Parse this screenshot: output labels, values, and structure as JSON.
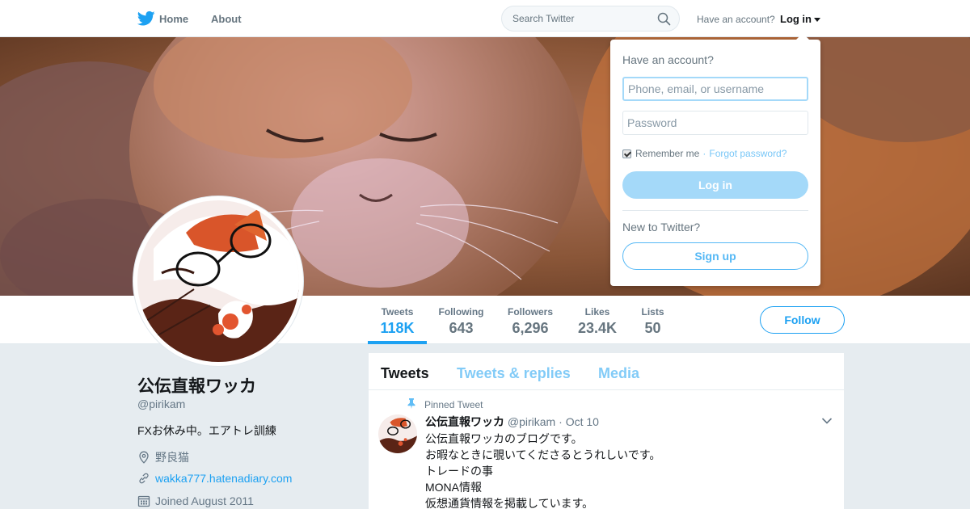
{
  "nav": {
    "home_label": "Home",
    "about_label": "About",
    "search_placeholder": "Search Twitter",
    "have_account": "Have an account?",
    "login_label": "Log in"
  },
  "profile": {
    "name": "公伝直報ワッカ",
    "handle": "@pirikam",
    "bio": "FXお休み中。エアトレ訓練",
    "location": "野良猫",
    "website": "wakka777.hatenadiary.com",
    "joined": "Joined August 2011"
  },
  "stats": [
    {
      "label": "Tweets",
      "value": "118K"
    },
    {
      "label": "Following",
      "value": "643"
    },
    {
      "label": "Followers",
      "value": "6,296"
    },
    {
      "label": "Likes",
      "value": "23.4K"
    },
    {
      "label": "Lists",
      "value": "50"
    }
  ],
  "follow_label": "Follow",
  "tabs": [
    "Tweets",
    "Tweets & replies",
    "Media"
  ],
  "tweet": {
    "pinned_label": "Pinned Tweet",
    "name": "公伝直報ワッカ",
    "handle": "@pirikam",
    "sep": "·",
    "time": "Oct 10",
    "lines": [
      "公伝直報ワッカのブログです。",
      "お暇なときに覗いてくださるとうれしいです。",
      "トレードの事",
      "MONA情報",
      "仮想通貨情報を掲載しています。"
    ]
  },
  "login_dropdown": {
    "title": "Have an account?",
    "username_placeholder": "Phone, email, or username",
    "password_placeholder": "Password",
    "remember_label": "Remember me",
    "sep": "·",
    "forgot_label": "Forgot password?",
    "login_button": "Log in",
    "new_label": "New to Twitter?",
    "signup_button": "Sign up"
  },
  "colors": {
    "accent": "#1da1f2",
    "background": "#e6ecf0",
    "muted_text": "#657786"
  }
}
